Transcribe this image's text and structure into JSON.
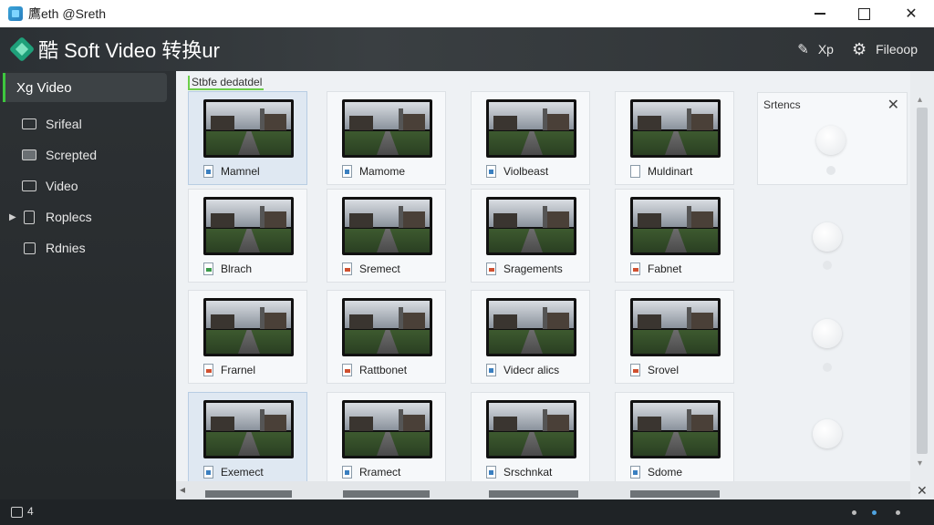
{
  "window": {
    "title": "鷹eth @Sreth"
  },
  "header": {
    "title": "酷 Soft Video 转换ur",
    "edit_label": "Xp",
    "settings_label": "Fileoop",
    "icons": {
      "edit": "edit-icon",
      "settings": "gear-icon"
    }
  },
  "sidebar": {
    "heading": "Xg Video",
    "items": [
      {
        "label": "Srifeal",
        "icon": "screen-icon"
      },
      {
        "label": "Screpted",
        "icon": "film-icon"
      },
      {
        "label": "Video",
        "icon": "video-icon"
      },
      {
        "label": "Roplecs",
        "icon": "document-icon",
        "expandable": true
      },
      {
        "label": "Rdnies",
        "icon": "square-icon"
      }
    ]
  },
  "content": {
    "label": "Stbfe dedatdel",
    "cards": [
      {
        "label": "Mamnel",
        "type": "blue",
        "selected": true
      },
      {
        "label": "Mamome",
        "type": "blue"
      },
      {
        "label": "Violbeast",
        "type": "blue"
      },
      {
        "label": "Muldinart",
        "type": "doc"
      },
      {
        "label": "Blrach",
        "type": "green"
      },
      {
        "label": "Sremect",
        "type": "red"
      },
      {
        "label": "Sragements",
        "type": "red"
      },
      {
        "label": "Fabnet",
        "type": "red"
      },
      {
        "label": "Frarnel",
        "type": "red"
      },
      {
        "label": "Rattbonet",
        "type": "red"
      },
      {
        "label": "Videcr alics",
        "type": "blue"
      },
      {
        "label": "Srovel",
        "type": "red"
      },
      {
        "label": "Exemect",
        "type": "blue",
        "selected": true
      },
      {
        "label": "Rramect",
        "type": "blue"
      },
      {
        "label": "Srschnkat",
        "type": "blue"
      },
      {
        "label": "Sdome",
        "type": "blue"
      }
    ]
  },
  "panel": {
    "title": "Srtencs",
    "close": "✕"
  },
  "scrollbar": {
    "close": "✕",
    "left_arrow": "◂",
    "up_arrow": "▴",
    "down_arrow": "▾"
  },
  "statusbar": {
    "text": "4"
  },
  "colors": {
    "accent": "#3ec73e",
    "header_bg": "#2b3034",
    "content_bg": "#eef1f4"
  }
}
